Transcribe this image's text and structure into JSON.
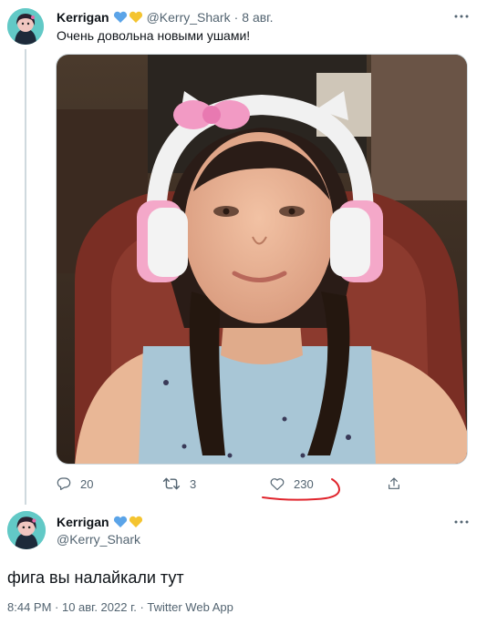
{
  "tweet": {
    "author_name": "Kerrigan",
    "author_handle": "@Kerry_Shark",
    "separator": "·",
    "time": "8 авг.",
    "text": "Очень довольна новыми ушами!",
    "replies": "20",
    "retweets": "3",
    "likes": "230"
  },
  "reply": {
    "author_name": "Kerrigan",
    "author_handle": "@Kerry_Shark",
    "text": "фига вы налайкали тут",
    "meta": "8:44 PM · 10 авг. 2022 г. · Twitter Web App"
  },
  "icons": {
    "heart_blue": "#5ba4e8",
    "heart_yellow": "#f4c430",
    "annotation_color": "#e0242c"
  }
}
